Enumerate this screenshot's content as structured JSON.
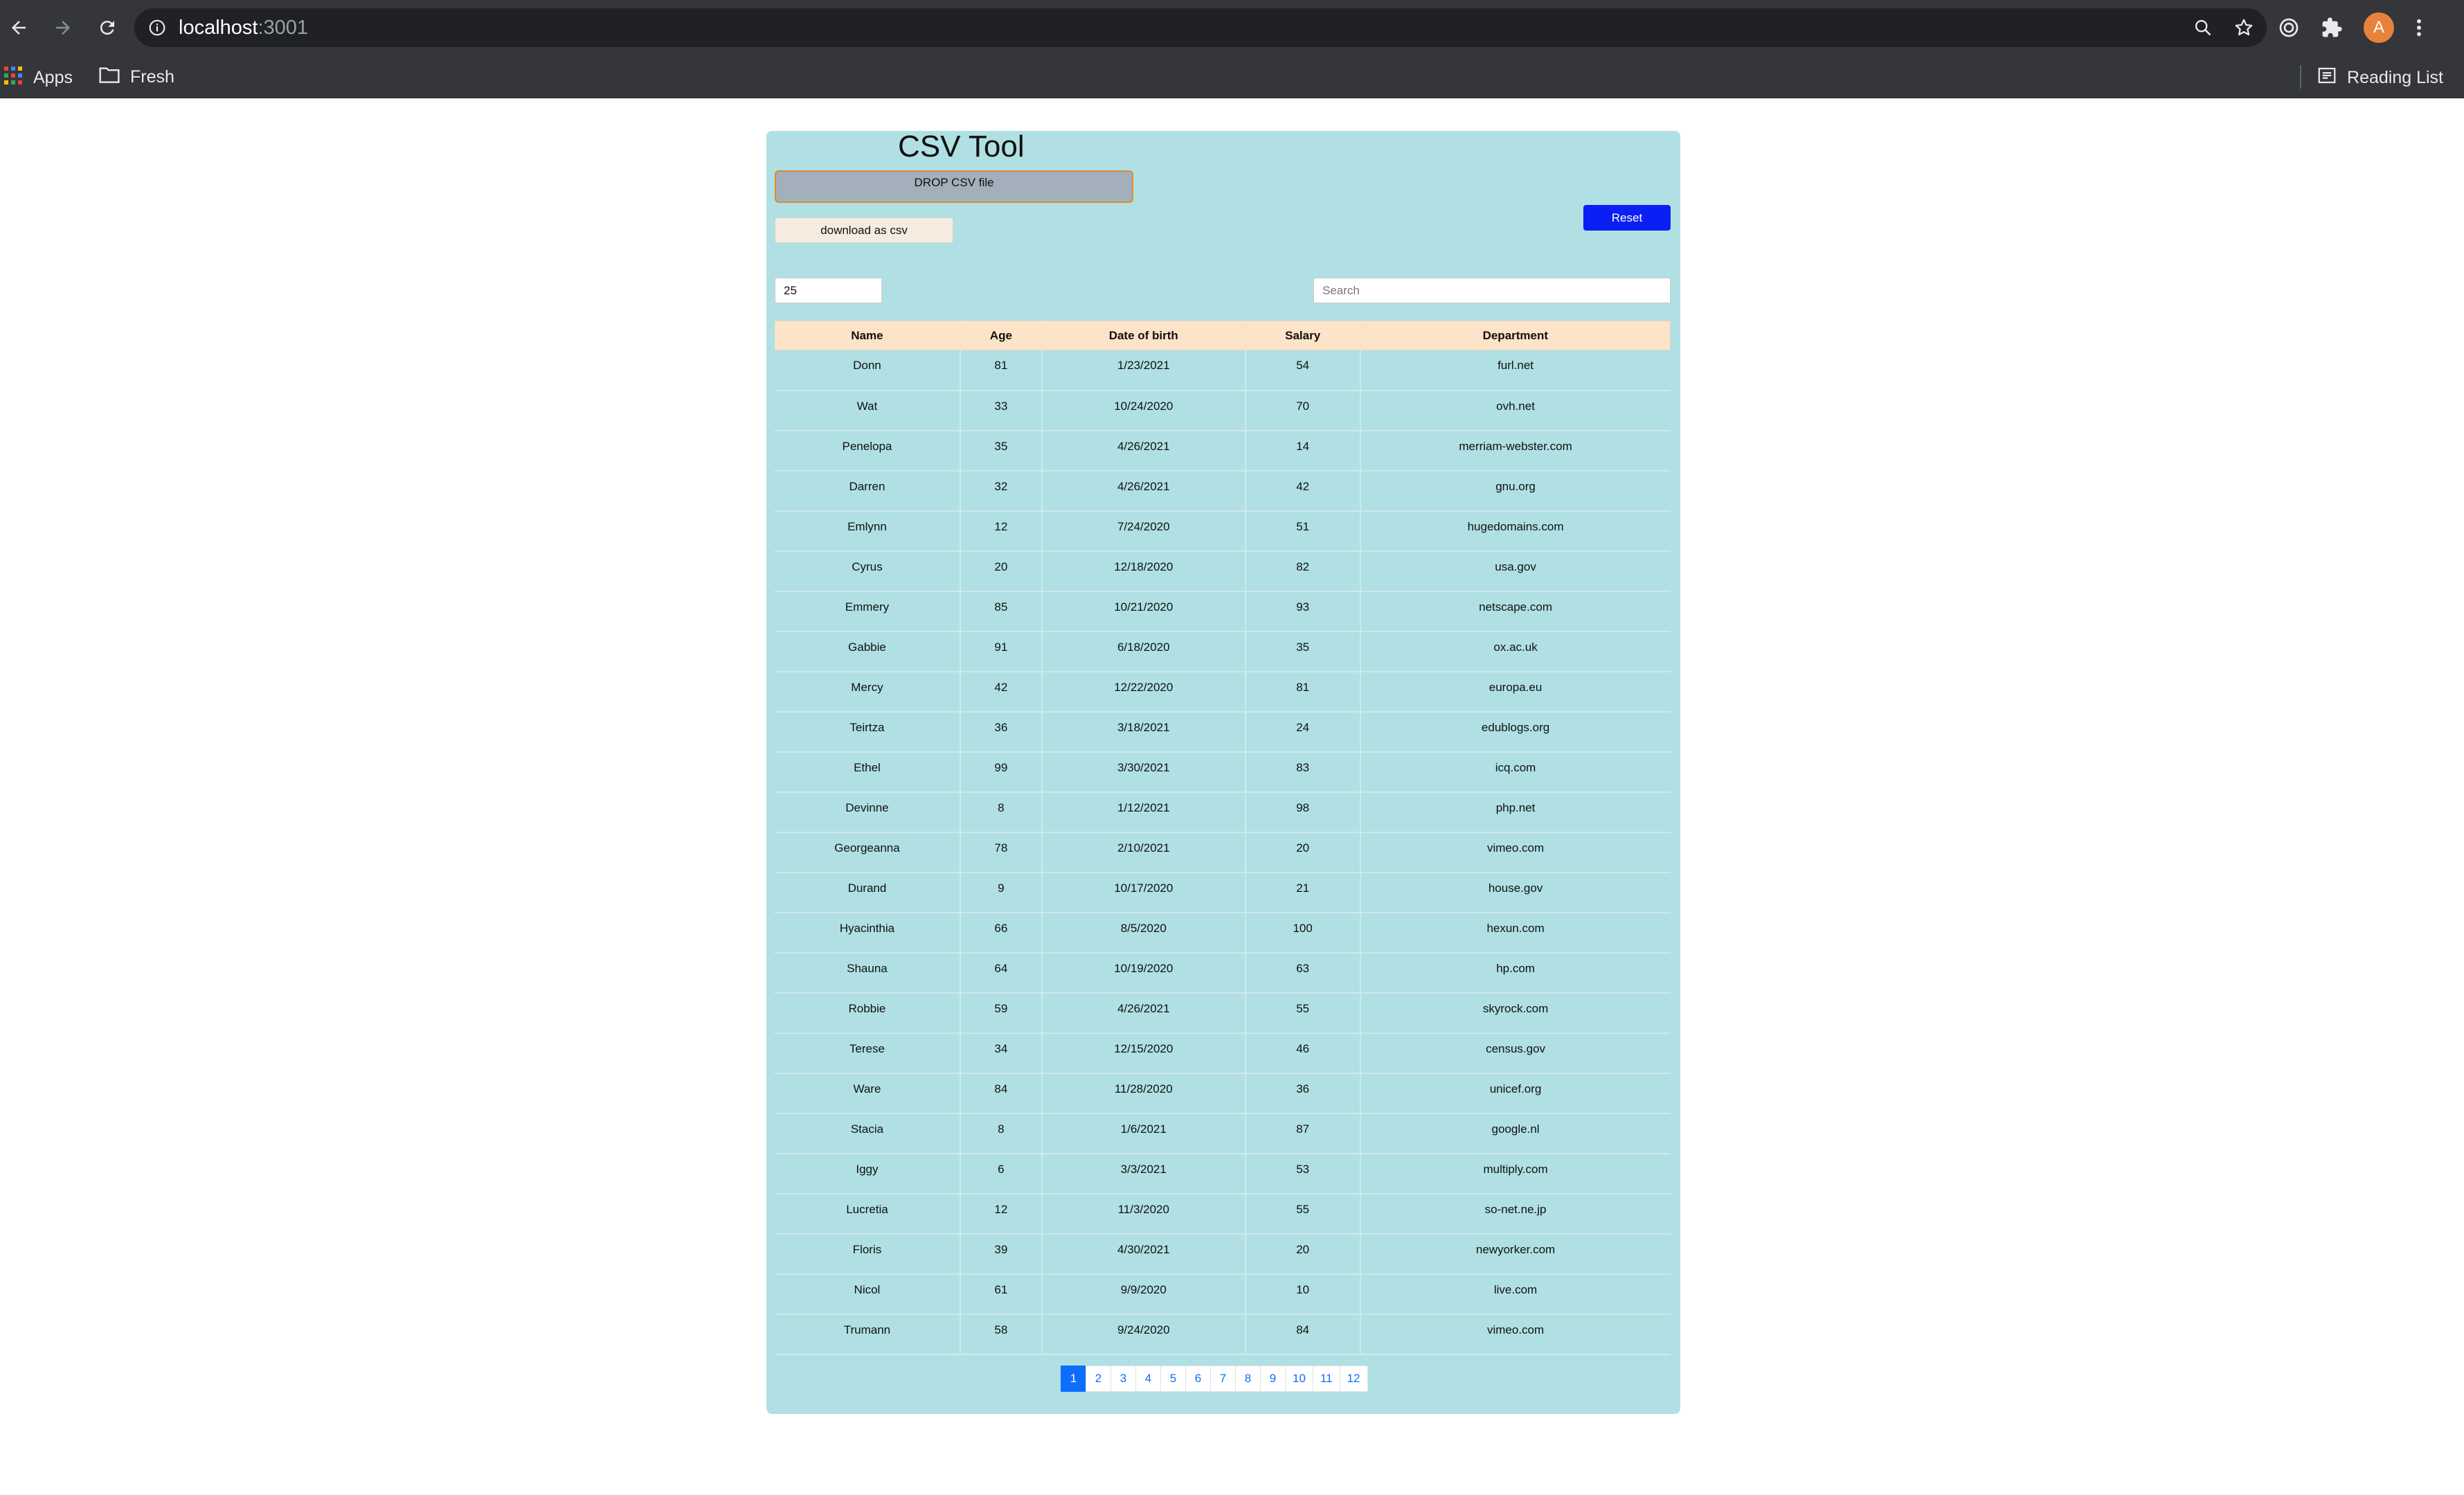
{
  "browser": {
    "url_host": "localhost",
    "url_port": ":3001",
    "avatar_letter": "A",
    "bookmarks": {
      "apps": "Apps",
      "fresh": "Fresh",
      "reading_list": "Reading List"
    }
  },
  "app": {
    "title": "CSV Tool",
    "dropzone_label": "DROP CSV file",
    "download_label": "download as csv",
    "reset_label": "Reset",
    "page_size_value": "25",
    "search_placeholder": "Search"
  },
  "table": {
    "columns": [
      "Name",
      "Age",
      "Date of birth",
      "Salary",
      "Department"
    ],
    "rows": [
      [
        "Donn",
        "81",
        "1/23/2021",
        "54",
        "furl.net"
      ],
      [
        "Wat",
        "33",
        "10/24/2020",
        "70",
        "ovh.net"
      ],
      [
        "Penelopa",
        "35",
        "4/26/2021",
        "14",
        "merriam-webster.com"
      ],
      [
        "Darren",
        "32",
        "4/26/2021",
        "42",
        "gnu.org"
      ],
      [
        "Emlynn",
        "12",
        "7/24/2020",
        "51",
        "hugedomains.com"
      ],
      [
        "Cyrus",
        "20",
        "12/18/2020",
        "82",
        "usa.gov"
      ],
      [
        "Emmery",
        "85",
        "10/21/2020",
        "93",
        "netscape.com"
      ],
      [
        "Gabbie",
        "91",
        "6/18/2020",
        "35",
        "ox.ac.uk"
      ],
      [
        "Mercy",
        "42",
        "12/22/2020",
        "81",
        "europa.eu"
      ],
      [
        "Teirtza",
        "36",
        "3/18/2021",
        "24",
        "edublogs.org"
      ],
      [
        "Ethel",
        "99",
        "3/30/2021",
        "83",
        "icq.com"
      ],
      [
        "Devinne",
        "8",
        "1/12/2021",
        "98",
        "php.net"
      ],
      [
        "Georgeanna",
        "78",
        "2/10/2021",
        "20",
        "vimeo.com"
      ],
      [
        "Durand",
        "9",
        "10/17/2020",
        "21",
        "house.gov"
      ],
      [
        "Hyacinthia",
        "66",
        "8/5/2020",
        "100",
        "hexun.com"
      ],
      [
        "Shauna",
        "64",
        "10/19/2020",
        "63",
        "hp.com"
      ],
      [
        "Robbie",
        "59",
        "4/26/2021",
        "55",
        "skyrock.com"
      ],
      [
        "Terese",
        "34",
        "12/15/2020",
        "46",
        "census.gov"
      ],
      [
        "Ware",
        "84",
        "11/28/2020",
        "36",
        "unicef.org"
      ],
      [
        "Stacia",
        "8",
        "1/6/2021",
        "87",
        "google.nl"
      ],
      [
        "Iggy",
        "6",
        "3/3/2021",
        "53",
        "multiply.com"
      ],
      [
        "Lucretia",
        "12",
        "11/3/2020",
        "55",
        "so-net.ne.jp"
      ],
      [
        "Floris",
        "39",
        "4/30/2021",
        "20",
        "newyorker.com"
      ],
      [
        "Nicol",
        "61",
        "9/9/2020",
        "10",
        "live.com"
      ],
      [
        "Trumann",
        "58",
        "9/24/2020",
        "84",
        "vimeo.com"
      ]
    ]
  },
  "pagination": {
    "pages": [
      "1",
      "2",
      "3",
      "4",
      "5",
      "6",
      "7",
      "8",
      "9",
      "10",
      "11",
      "12"
    ],
    "active": "1"
  },
  "colors": {
    "panel_bg": "#b0e0e3",
    "header_bg": "#fde3c8",
    "reset_bg": "#0b1ff5",
    "active_page": "#0d6efd"
  }
}
